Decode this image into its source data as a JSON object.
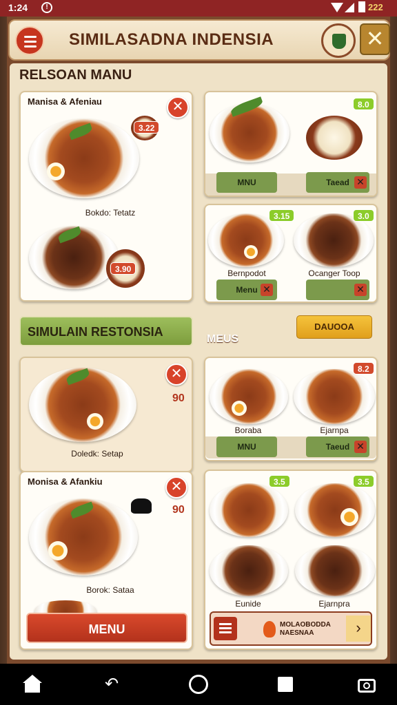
{
  "status_bar": {
    "time": "1:24",
    "notif_icon": "notification-icon",
    "battery": "222"
  },
  "header": {
    "title": "SIMILASADNA INDENSIA",
    "logo": "restaurant-logo",
    "close_icon": "close-icon",
    "menu_icon": "hamburger-icon"
  },
  "section_title": "RELSOAN MANU",
  "card_main": {
    "title": "Manisa & Afeniau",
    "badge": "3.22",
    "caption": "Bokdo: Tetatz",
    "price_badge": "3.90"
  },
  "card_top_right": {
    "chip": "8.0",
    "btn_left": "MNU",
    "btn_right": "Taead"
  },
  "card_mid_right": {
    "chip_left": "3.15",
    "chip_right": "3.0",
    "caption_left": "Bernpodot",
    "caption_right": "Ocanger Toop",
    "btn_left": "Menu"
  },
  "banner": {
    "label": "SIMULAIN RESTONSIA"
  },
  "orange_button": {
    "label": "DAUOOA"
  },
  "menus_label": "MEUS",
  "card_lower_left": {
    "price": "90",
    "caption": "Doledk: Setap"
  },
  "card_bottom_left": {
    "title": "Monisa & Afankiu",
    "price": "90",
    "caption": "Borok: Sataa",
    "button": "MENU"
  },
  "card_lower_right": {
    "chip": "8.2",
    "caption_left": "Boraba",
    "caption_right": "Ejarnpa",
    "btn_left": "MNU",
    "btn_right": "Taeud"
  },
  "card_bottom_right": {
    "chip_left": "3.5",
    "chip_right": "3.5",
    "caption_left": "Eunide",
    "caption_right": "Ejarnpra"
  },
  "bottom_bar": {
    "line1": "MOLAOBODDA",
    "line2": "NAESNAA"
  },
  "nav": {
    "home": "home-icon",
    "back": "back-icon",
    "circle": "home-circle-icon",
    "recents": "recents-icon",
    "camera": "camera-icon"
  },
  "colors": {
    "accent_red": "#c6351f",
    "green": "#7c9a4c",
    "brown": "#7b4a2d",
    "cream": "#efe2c7"
  }
}
